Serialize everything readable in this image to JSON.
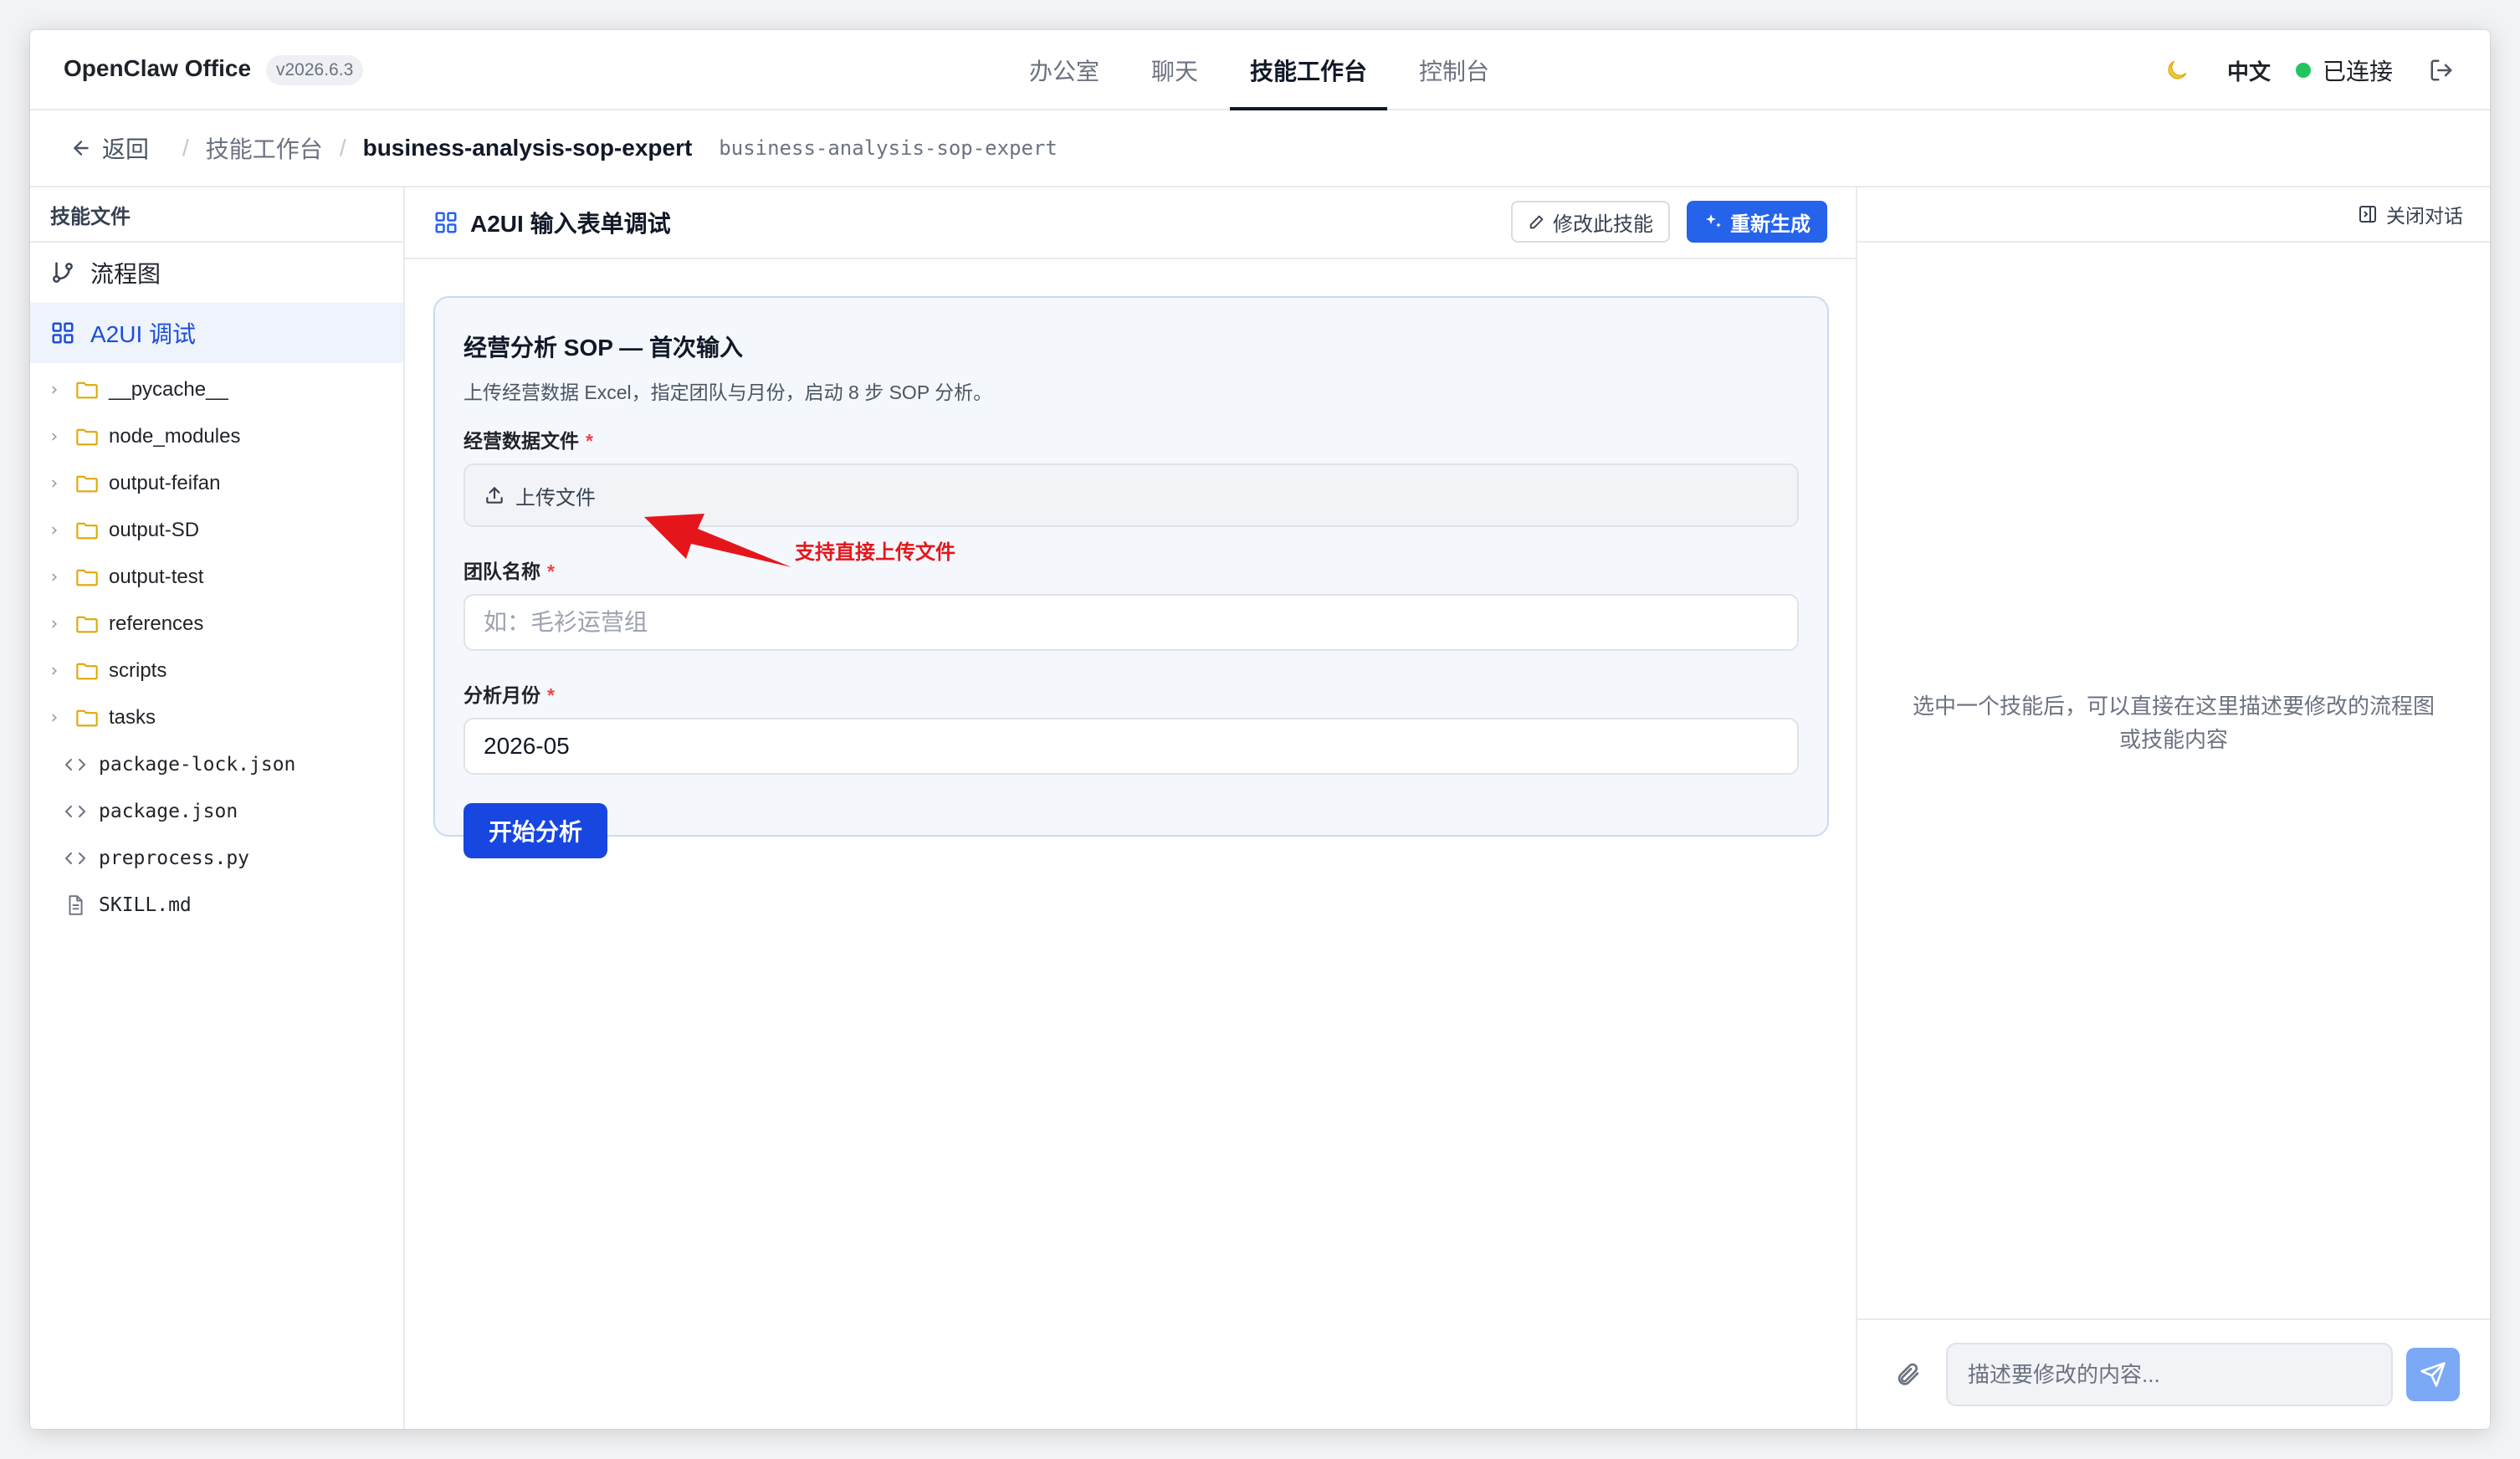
{
  "app": {
    "title": "OpenClaw Office",
    "version": "v2026.6.3"
  },
  "nav": {
    "items": [
      {
        "label": "办公室"
      },
      {
        "label": "聊天"
      },
      {
        "label": "技能工作台"
      },
      {
        "label": "控制台"
      }
    ],
    "active_index": 2
  },
  "topbar_right": {
    "language": "中文",
    "connection_status": "已连接",
    "status_color": "#22c55e"
  },
  "breadcrumb": {
    "back_label": "返回",
    "workbench": "技能工作台",
    "skill_name": "business-analysis-sop-expert",
    "skill_id": "business-analysis-sop-expert"
  },
  "sidebar": {
    "header": "技能文件",
    "nav": [
      {
        "label": "流程图",
        "icon": "branch-icon"
      },
      {
        "label": "A2UI 调试",
        "icon": "grid-icon"
      }
    ],
    "active_nav": 1,
    "folders": [
      "__pycache__",
      "node_modules",
      "output-feifan",
      "output-SD",
      "output-test",
      "references",
      "scripts",
      "tasks"
    ],
    "files": [
      {
        "name": "package-lock.json",
        "icon": "code-icon"
      },
      {
        "name": "package.json",
        "icon": "code-icon"
      },
      {
        "name": "preprocess.py",
        "icon": "code-icon"
      },
      {
        "name": "SKILL.md",
        "icon": "document-icon"
      }
    ]
  },
  "center": {
    "header_title": "A2UI 输入表单调试",
    "edit_button": "修改此技能",
    "regen_button": "重新生成",
    "form": {
      "title": "经营分析 SOP — 首次输入",
      "description": "上传经营数据 Excel，指定团队与月份，启动 8 步 SOP 分析。",
      "file_label": "经营数据文件",
      "required_mark": "*",
      "upload_label": "上传文件",
      "team_label": "团队名称",
      "team_placeholder": "如：毛衫运营组",
      "month_label": "分析月份",
      "month_value": "2026-05",
      "submit_label": "开始分析"
    },
    "annotation": {
      "text": "支持直接上传文件",
      "color": "#e5161b"
    }
  },
  "right_panel": {
    "close_label": "关闭对话",
    "empty_hint_line1": "选中一个技能后，可以直接在这里描述要修改的流程图",
    "empty_hint_line2": "或技能内容",
    "chat_placeholder": "描述要修改的内容..."
  },
  "colors": {
    "accent": "#2563eb",
    "primary_button": "#1746e0",
    "active_nav_bg": "#eef3fc"
  }
}
